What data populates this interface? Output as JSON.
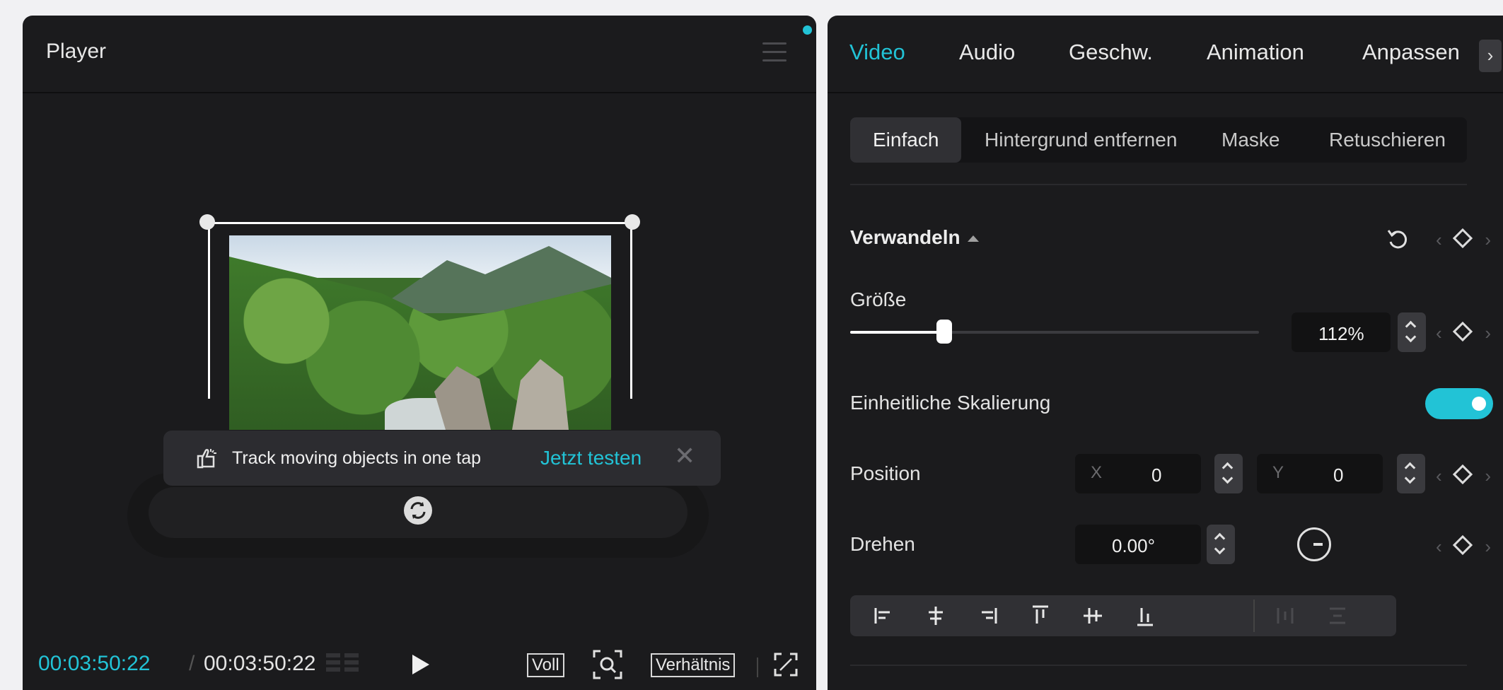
{
  "player": {
    "title": "Player",
    "toast": {
      "text": "Track moving objects in one tap",
      "link": "Jetzt testen",
      "close": "✕"
    },
    "footer": {
      "current_time": "00:03:50:22",
      "separator": "/",
      "total_time": "00:03:50:22",
      "full_label": "Voll",
      "ratio_label": "Verhältnis"
    }
  },
  "tabs": [
    "Video",
    "Audio",
    "Geschw.",
    "Animation",
    "Anpassen"
  ],
  "active_tab": "Video",
  "tab_more": "›",
  "subtabs": [
    "Einfach",
    "Hintergrund entfernen",
    "Maske",
    "Retuschieren"
  ],
  "section": {
    "title": "Verwandeln"
  },
  "size": {
    "label": "Größe",
    "value": "112%",
    "slider_fraction": 0.23
  },
  "uniform_scale": {
    "label": "Einheitliche Skalierung",
    "enabled": true
  },
  "position": {
    "label": "Position",
    "x_placeholder": "X",
    "x_value": "0",
    "y_placeholder": "Y",
    "y_value": "0"
  },
  "rotate": {
    "label": "Drehen",
    "value": "0.00°"
  },
  "colors": {
    "accent": "#22c3d6",
    "panel_bg": "#1b1b1d",
    "page_bg": "#f1f1f3"
  },
  "icons": {
    "menu": "menu-icon",
    "track": "hand-tap-icon",
    "play": "play-icon",
    "zoom": "zoom-icon",
    "fullscreen": "fullscreen-icon",
    "reset": "reset-icon",
    "keyframe": "keyframe-diamond-icon",
    "rotate_handle": "rotate-handle-icon"
  }
}
